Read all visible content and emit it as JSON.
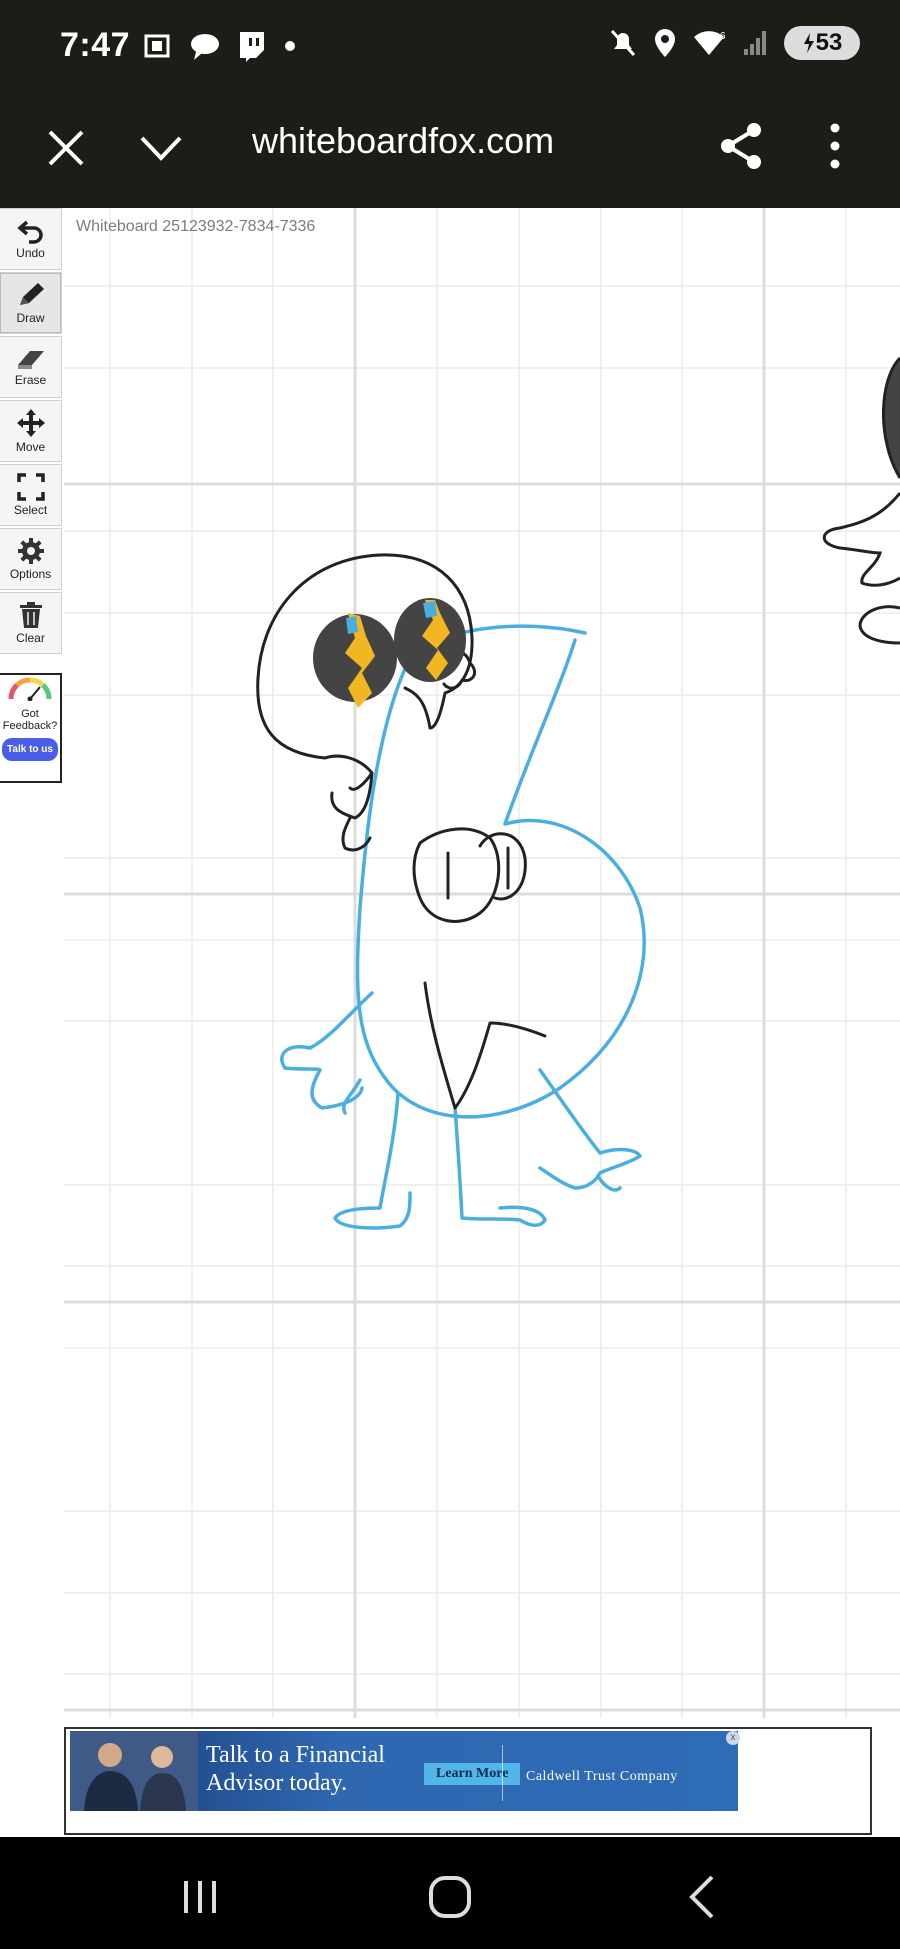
{
  "status_bar": {
    "time": "7:47",
    "battery": "53",
    "left_icons": [
      "screenshot-icon",
      "chat-icon",
      "twitch-icon",
      "dot-icon"
    ],
    "right_icons": [
      "mute-icon",
      "location-icon",
      "wifi-icon",
      "signal-icon",
      "battery-icon"
    ]
  },
  "browser": {
    "url": "whiteboardfox.com",
    "icons": [
      "close-icon",
      "chevron-down-icon",
      "share-icon",
      "more-vert-icon"
    ]
  },
  "whiteboard": {
    "title": "Whiteboard 25123932-7834-7336",
    "tools": [
      {
        "label": "Undo",
        "icon": "undo-icon",
        "active": false
      },
      {
        "label": "Draw",
        "icon": "pencil-icon",
        "active": true
      },
      {
        "label": "Erase",
        "icon": "eraser-icon",
        "active": false
      },
      {
        "label": "Move",
        "icon": "move-icon",
        "active": false
      },
      {
        "label": "Select",
        "icon": "select-icon",
        "active": false
      },
      {
        "label": "Options",
        "icon": "gear-icon",
        "active": false
      },
      {
        "label": "Clear",
        "icon": "trash-icon",
        "active": false
      }
    ],
    "feedback": {
      "text": "Got Feedback?",
      "button": "Talk to us"
    },
    "drawing_colors": {
      "black": "#222222",
      "blue": "#4aafe0",
      "yellow": "#f2b620",
      "gray": "#444444"
    }
  },
  "ad": {
    "headline": "Talk to a Financial Advisor today.",
    "cta": "Learn More",
    "brand": "Caldwell Trust Company",
    "close": "x"
  },
  "nav": {
    "icons": [
      "recents-icon",
      "home-icon",
      "back-icon"
    ]
  }
}
